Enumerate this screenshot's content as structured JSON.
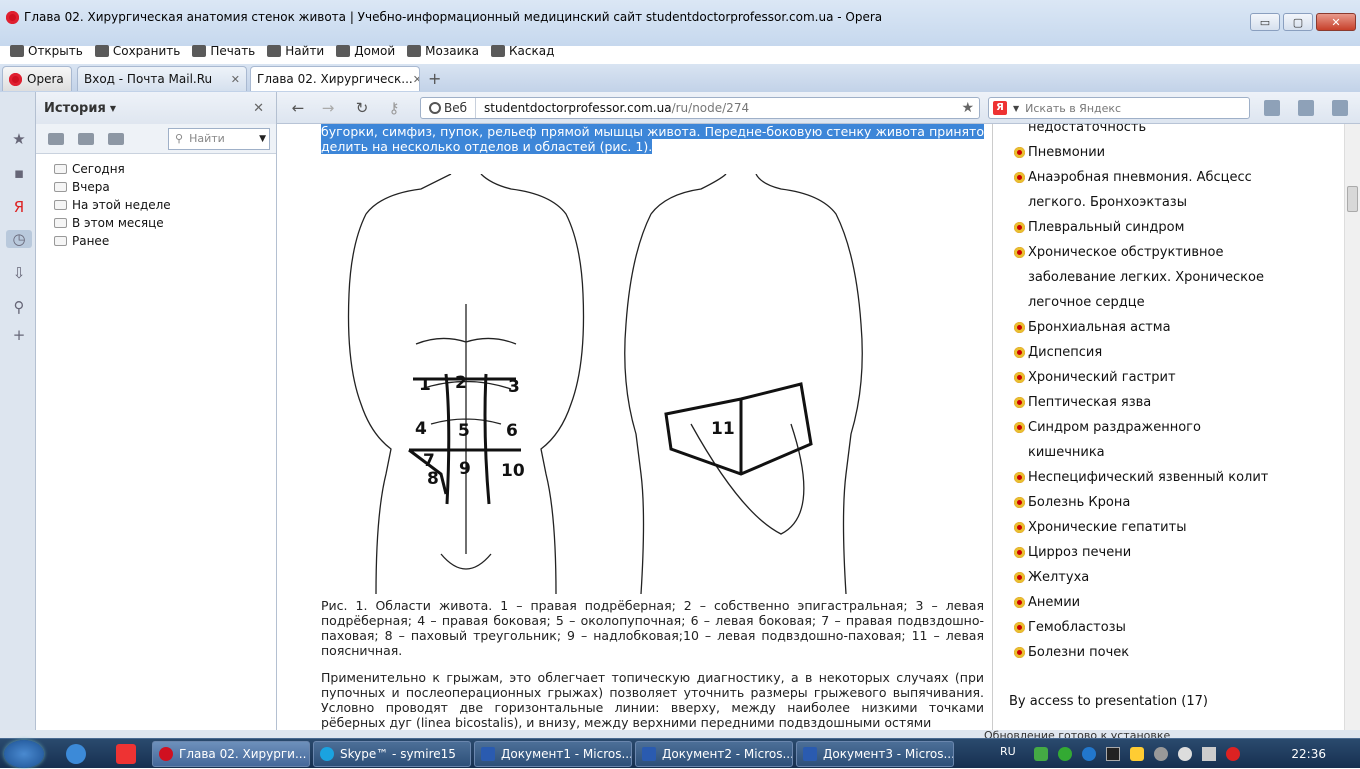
{
  "window": {
    "title": "Глава 02. Хирургическая анатомия стенок живота | Учебно-информационный медицинский сайт studentdoctorprofessor.com.ua - Opera",
    "controls": [
      "▭",
      "▢",
      "✕"
    ]
  },
  "menu": [
    {
      "label": "Открыть",
      "icon": "folder-icon"
    },
    {
      "label": "Сохранить",
      "icon": "save-icon"
    },
    {
      "label": "Печать",
      "icon": "print-icon"
    },
    {
      "label": "Найти",
      "icon": "search-icon"
    },
    {
      "label": "Домой",
      "icon": "home-icon"
    },
    {
      "label": "Мозаика",
      "icon": "tile-icon"
    },
    {
      "label": "Каскад",
      "icon": "cascade-icon"
    }
  ],
  "tabs": {
    "opera_label": "Opera",
    "items": [
      {
        "label": "Вход - Почта Mail.Ru",
        "close": "✕"
      },
      {
        "label": "Глава 02. Хирургическ...",
        "close": "✕"
      }
    ],
    "add": "+"
  },
  "address": {
    "web_label": "Веб",
    "host": "studentdoctorprofessor.com.ua",
    "path": "/ru/node/274",
    "search_placeholder": "Искать в Яндекс",
    "ya_label": "Я"
  },
  "panel": {
    "title": "История",
    "find_placeholder": "Найти",
    "folders": [
      "Сегодня",
      "Вчера",
      "На этой неделе",
      "В этом месяце",
      "Ранее"
    ]
  },
  "article": {
    "highlight": "бугорки, симфиз, пупок, рельеф прямой мышцы живота. Передне-боковую стенку живота принято делить на несколько отделов и областей (рис. 1).",
    "figure_labels": [
      "1",
      "2",
      "3",
      "4",
      "5",
      "6",
      "7",
      "8",
      "9",
      "10",
      "11"
    ],
    "caption": "Рис. 1. Области живота. 1 – правая подрёберная; 2 – собственно эпигастральная; 3 – левая подрёберная; 4 – правая боковая; 5 – околопупочная; 6 – левая боковая; 7 – правая подвздошно-паховая; 8 – паховый треугольник; 9 – надлобковая;10 – левая подвздошно-паховая; 11 – левая поясничная.",
    "paragraph": "Применительно к грыжам, это облегчает топическую диагностику, а в некоторых случаях (при пупочных и послеоперационных грыжах) позволяет уточнить размеры грыжевого выпячивания. Условно проводят две горизонтальные линии: вверху, между наиболее низкими точками рёберных дуг (linea bicostalis), и внизу, между верхними передними подвздошными остями"
  },
  "sidebar": {
    "top_cut": "недостаточность",
    "items": [
      "Пневмонии",
      "Анаэробная пневмония. Абсцесс легкого. Бронхоэктазы",
      "Плевральный синдром",
      "Хроническое обструктивное заболевание легких. Хроническое легочное сердце",
      "Бронхиальная астма",
      "Диспепсия",
      "Хронический гастрит",
      "Пептическая язва",
      "Синдром раздраженного кишечника",
      "Неспецифический язвенный колит",
      "Болезнь Крона",
      "Хронические гепатиты",
      "Цирроз печени",
      "Желтуха",
      "Анемии",
      "Гемобластозы",
      "Болезни почек"
    ],
    "access": "By access to presentation (17)"
  },
  "status": {
    "text": "Обновление готово к установке"
  },
  "taskbar": {
    "tasks": [
      {
        "label": "Глава 02. Хирурги...",
        "color": "#d01020"
      },
      {
        "label": "Skype™ - symire15",
        "color": "#1aa3e0"
      },
      {
        "label": "Документ1 - Micros...",
        "color": "#2a5bb0"
      },
      {
        "label": "Документ2 - Micros...",
        "color": "#2a5bb0"
      },
      {
        "label": "Документ3 - Micros...",
        "color": "#2a5bb0"
      }
    ],
    "lang": "RU",
    "clock": "22:36"
  }
}
